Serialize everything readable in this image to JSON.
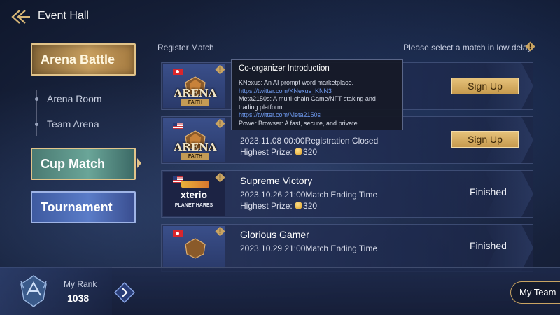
{
  "header": {
    "title": "Event Hall"
  },
  "menu": {
    "arena_battle": "Arena Battle",
    "arena_room": "Arena Room",
    "team_arena": "Team Arena",
    "cup_match": "Cup Match",
    "tournament": "Tournament"
  },
  "list": {
    "register_label": "Register Match",
    "hint": "Please select a match in low delay."
  },
  "tooltip": {
    "title": "Co-organizer Introduction",
    "lines": [
      "KNexus: An AI prompt word marketplace.",
      "https://twitter.com/KNexus_KNN3",
      "Meta2150s: A multi-chain Game/NFT staking and trading platform.",
      "https://twitter.com/Meta2150s",
      "Power Browser: A fast, secure, and private"
    ]
  },
  "matches": [
    {
      "flag": "hk",
      "logo": "ARENA",
      "logo_sub": "FAITH",
      "action": "Sign Up"
    },
    {
      "flag": "us",
      "logo": "ARENA",
      "logo_sub": "FAITH",
      "date": "2023.11.08 00:00",
      "status_text": "Registration Closed",
      "prize_label": "Highest Prize:",
      "prize": "320",
      "action": "Sign Up"
    },
    {
      "flag": "us",
      "logo": "xterio",
      "logo_sub": "PLANET HARES",
      "title": "Supreme Victory",
      "date": "2023.10.26 21:00",
      "status_text": "Match Ending Time",
      "prize_label": "Highest Prize:",
      "prize": "320",
      "action": "Finished"
    },
    {
      "flag": "hk",
      "title": "Glorious Gamer",
      "date": "2023.10.29 21:00",
      "status_text": "Match Ending Time",
      "action": "Finished"
    }
  ],
  "footer": {
    "rank_label": "My Rank",
    "rank_value": "1038",
    "my_team": "My Team"
  },
  "colors": {
    "gold": "#c69a4e",
    "link": "#6f9bf0",
    "cup_selected": "#6aa598",
    "tournament": "#5a7cc8"
  },
  "icons": [
    "back-arrow-icon",
    "warning-diamond-icon",
    "coin-icon",
    "rank-emblem-icon",
    "chevron-right-icon"
  ]
}
